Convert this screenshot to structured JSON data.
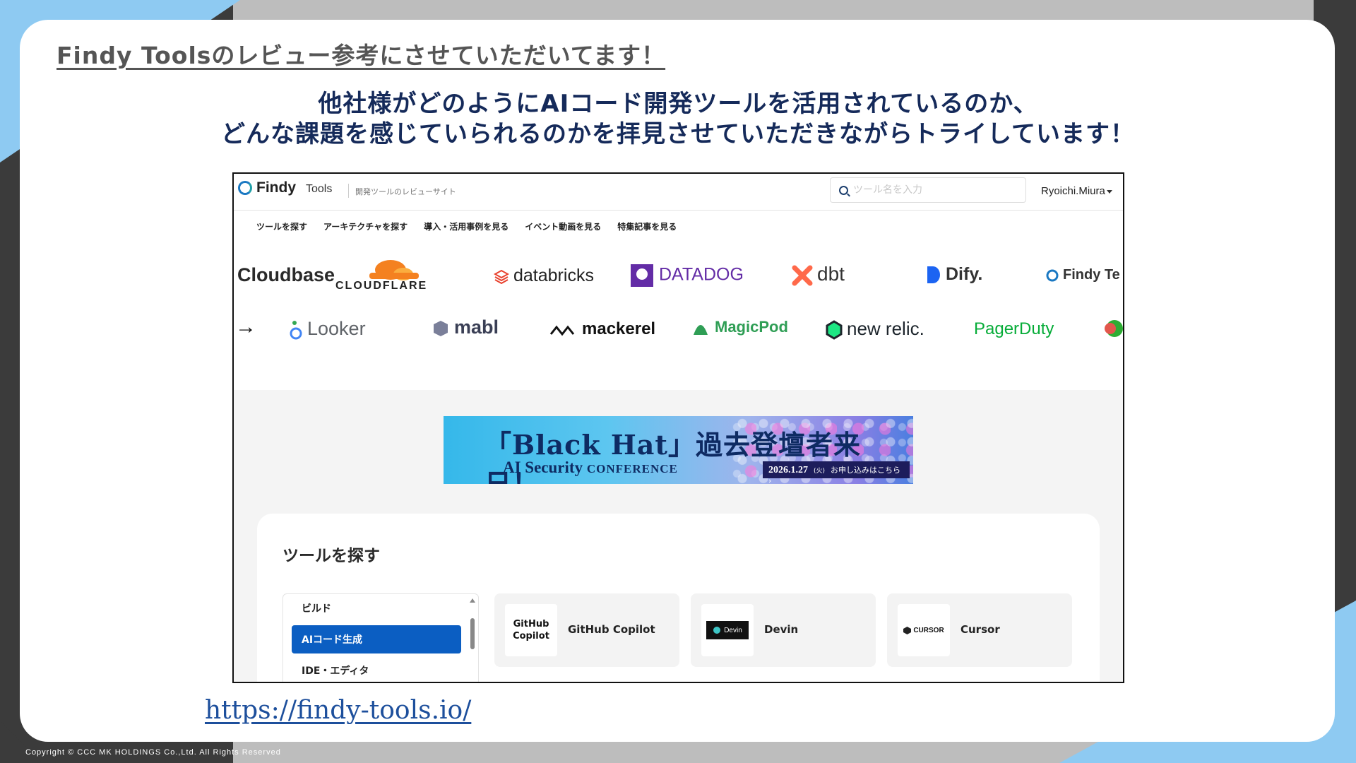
{
  "slide": {
    "heading": "Findy Toolsのレビュー参考にさせていただいてます！",
    "subtitle_line1": "他社様がどのようにAIコード開発ツールを活用されているのか、",
    "subtitle_line2": "どんな課題を感じていられるのかを拝見させていただきながらトライしています！",
    "url": "https://findy-tools.io/",
    "copyright": "Copyright © CCC MK HOLDINGS Co.,Ltd. All Rights Reserved"
  },
  "site": {
    "logo_text": "Findy",
    "logo_sub": "Tools",
    "tagline": "開発ツールのレビューサイト",
    "search_placeholder": "ツール名を入力",
    "user": "Ryoichi.Miura",
    "nav": [
      "ツールを探す",
      "アーキテクチャを探す",
      "導入・活用事例を見る",
      "イベント動画を見る",
      "特集記事を見る"
    ],
    "brands_row1": [
      "Cloudbase",
      "CLOUDFLARE",
      "databricks",
      "DATADOG",
      "dbt",
      "Dify.",
      "Findy Te"
    ],
    "brands_row2": [
      "Looker",
      "mabl",
      "mackerel",
      "MagicPod",
      "new relic.",
      "PagerDuty"
    ],
    "banner": {
      "title": "「Black Hat」過去登壇者来日！",
      "sub_main": "AI Security",
      "sub_small": "CONFERENCE",
      "date": "2026.1.27",
      "dow": "(火)",
      "cta": "お申し込みはこちら ›"
    },
    "panel": {
      "title": "ツールを探す",
      "categories": [
        "ビルド",
        "AIコード生成",
        "IDE・エディタ"
      ],
      "tools": [
        {
          "logo_line1": "GitHub",
          "logo_line2": "Copilot",
          "name": "GitHub Copilot"
        },
        {
          "logo": "Devin",
          "name": "Devin"
        },
        {
          "logo": "CURSOR",
          "name": "Cursor"
        }
      ]
    }
  },
  "colors": {
    "navy": "#152a5a",
    "accent_blue": "#0b5ec2",
    "frame_light_blue": "#8ecaf2",
    "frame_dark": "#3b3b3b"
  }
}
